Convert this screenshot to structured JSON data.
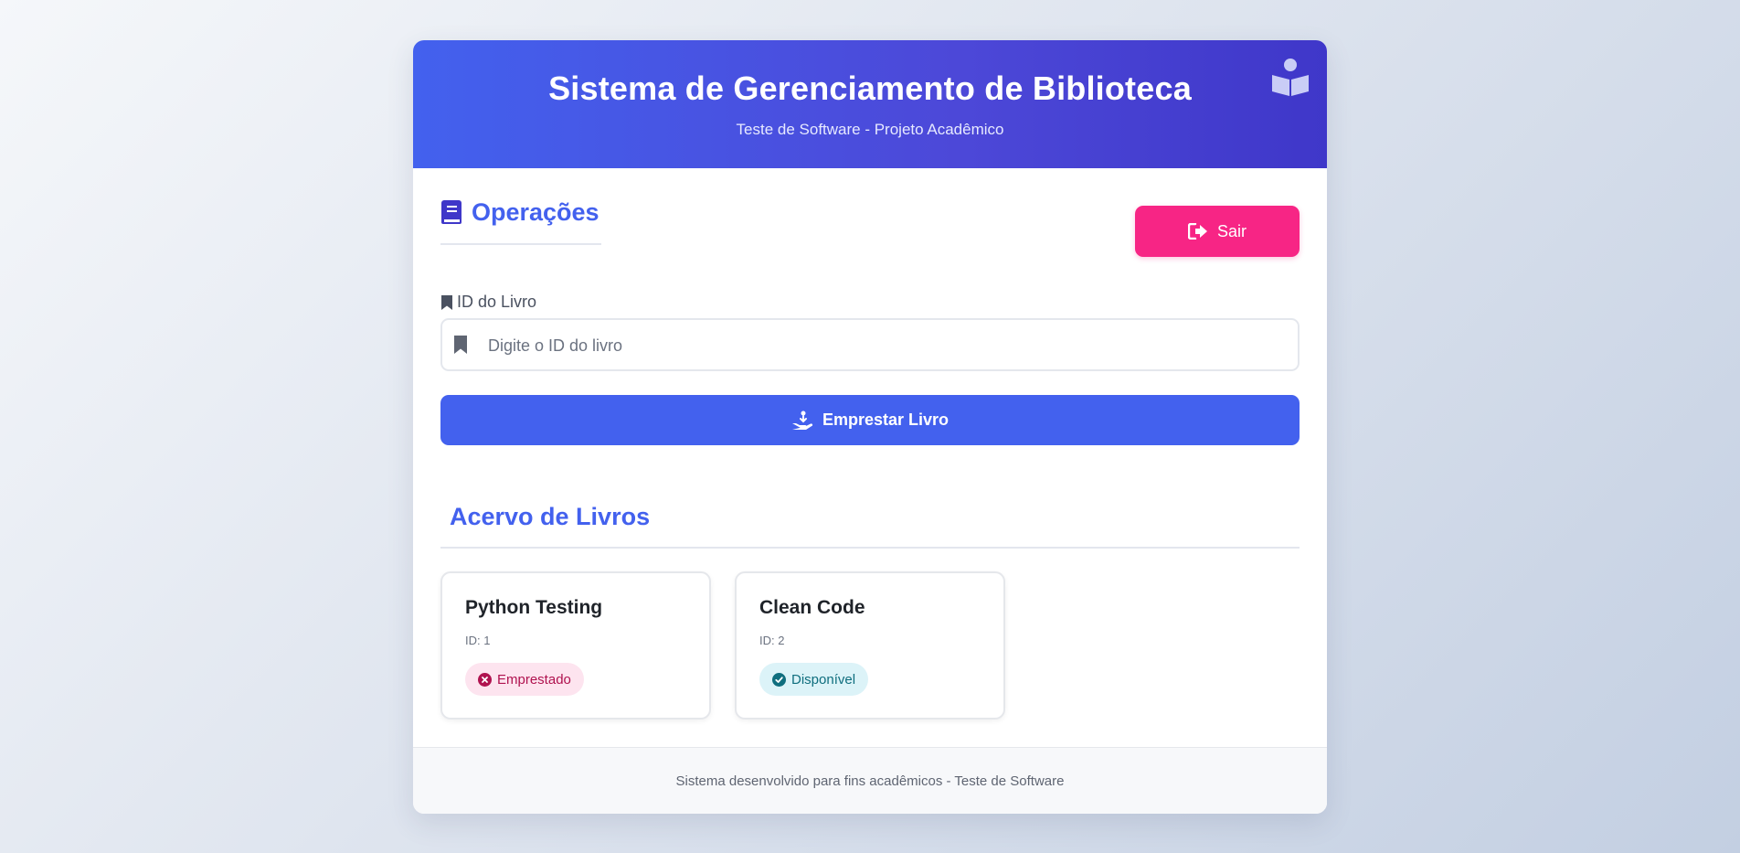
{
  "header": {
    "title": "Sistema de Gerenciamento de Biblioteca",
    "subtitle": "Teste de Software - Projeto Acadêmico",
    "icon": "reading-user-icon"
  },
  "operations": {
    "title": "Operações",
    "title_icon": "book-icon",
    "logout_label": "Sair",
    "logout_icon": "sign-out-icon",
    "book_id_label": "ID do Livro",
    "book_id_label_icon": "bookmark-icon",
    "book_id_placeholder": "Digite o ID do livro",
    "book_id_value": "",
    "borrow_label": "Emprestar Livro",
    "borrow_icon": "hand-holding-icon"
  },
  "collection": {
    "title": "Acervo de Livros",
    "books": [
      {
        "title": "Python Testing",
        "id_text": "ID: 1",
        "status": "Emprestado",
        "status_type": "borrowed"
      },
      {
        "title": "Clean Code",
        "id_text": "ID: 2",
        "status": "Disponível",
        "status_type": "available"
      }
    ]
  },
  "footer": {
    "text": "Sistema desenvolvido para fins acadêmicos - Teste de Software"
  },
  "colors": {
    "primary": "#4361ee",
    "secondary": "#3f37c9",
    "danger": "#f72585",
    "borrowed_badge_bg": "#fde4ef",
    "available_badge_bg": "#dcf3f8"
  }
}
